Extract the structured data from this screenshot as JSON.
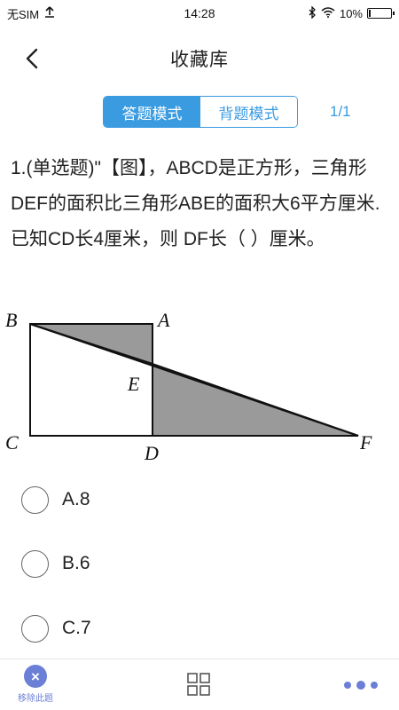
{
  "status_bar": {
    "carrier": "无SIM",
    "time": "14:28",
    "battery_text": "10%",
    "battery_level": 0.1
  },
  "nav": {
    "title": "收藏库"
  },
  "modes": {
    "answer_mode": "答题模式",
    "recite_mode": "背题模式",
    "page_count": "1/1"
  },
  "question": {
    "text": "1.(单选题)\"【图】，ABCD是正方形，三角形DEF的面积比三角形ABE的面积大6平方厘米.已知CD长4厘米，则 DF长（ ）厘米。"
  },
  "figure": {
    "labels": {
      "B": "B",
      "A": "A",
      "E": "E",
      "C": "C",
      "D": "D",
      "F": "F"
    }
  },
  "options": [
    {
      "label": "A.8"
    },
    {
      "label": "B.6"
    },
    {
      "label": "C.7"
    }
  ],
  "bottom_bar": {
    "remove_label": "移除此题"
  },
  "colors": {
    "accent": "#3a9be0",
    "bottom_icon": "#6b7fd7",
    "shaded": "#9a9a9a"
  }
}
